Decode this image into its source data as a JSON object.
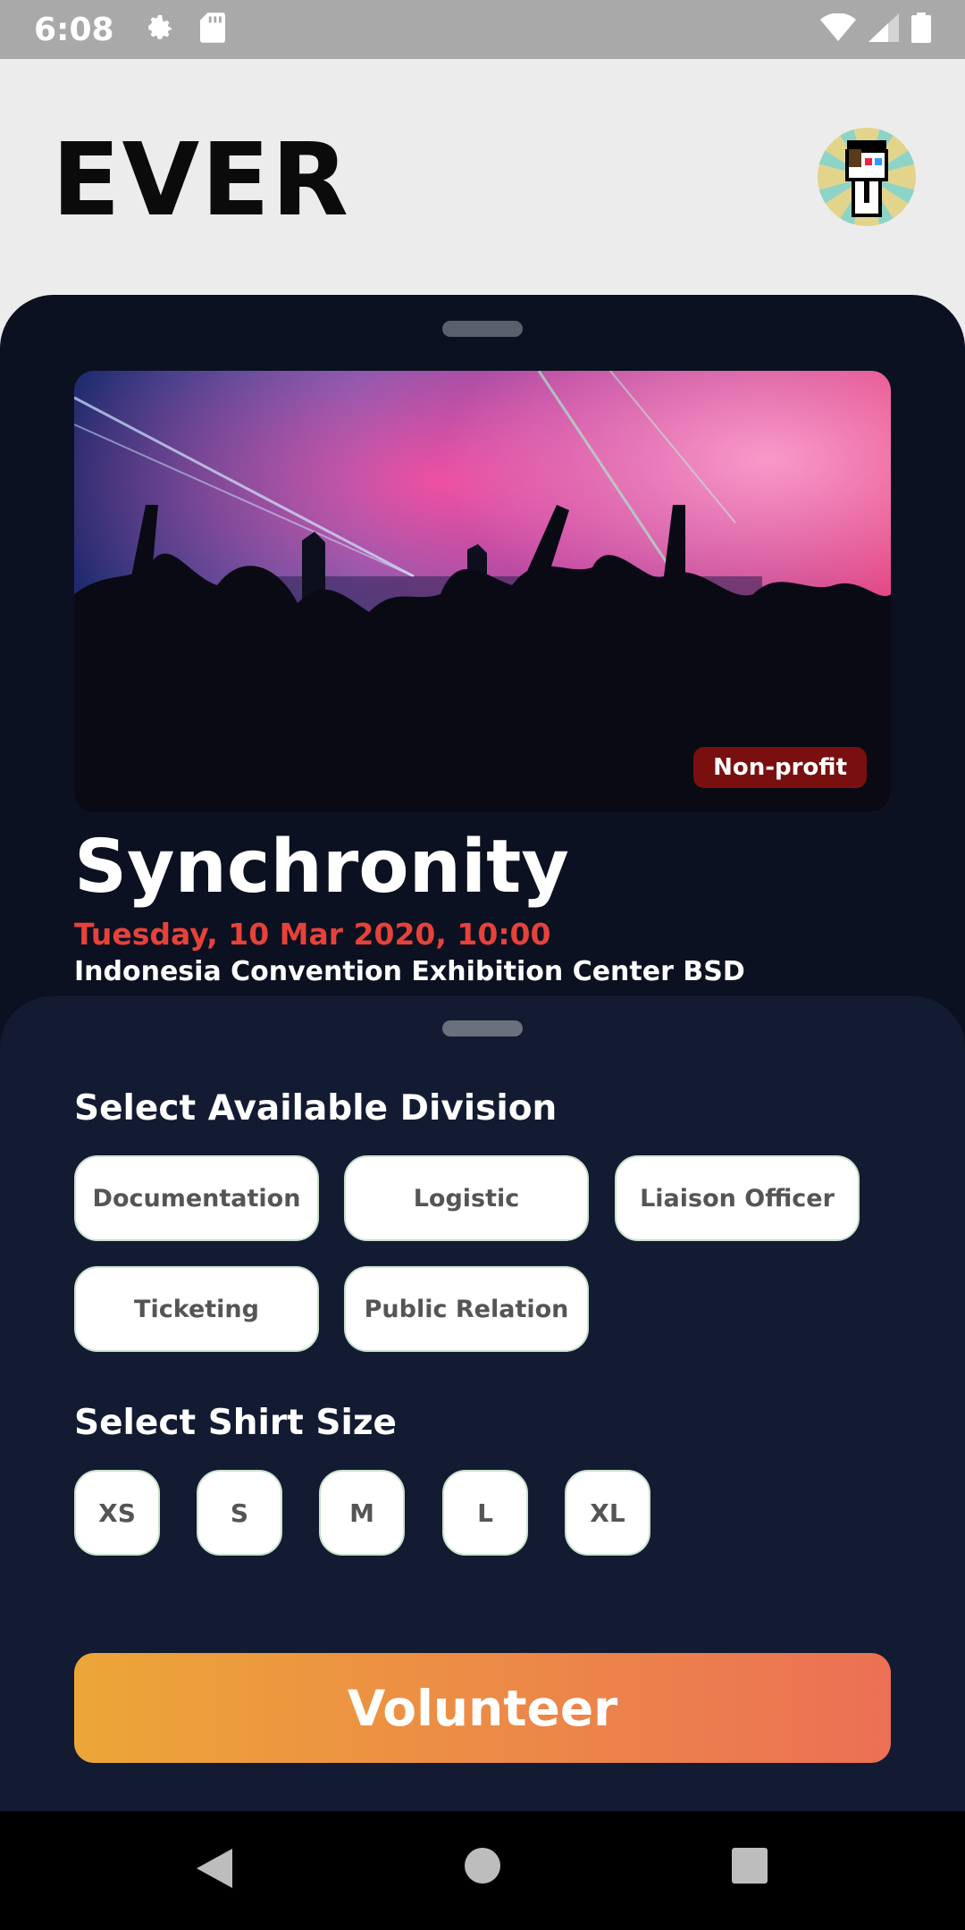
{
  "status_bar": {
    "time": "6:08",
    "icons_left": [
      "settings-icon",
      "sd-card-icon"
    ],
    "icons_right": [
      "wifi-icon",
      "signal-icon",
      "battery-icon"
    ]
  },
  "header": {
    "logo": "EVER",
    "avatar": "pixel-avatar"
  },
  "event": {
    "badge": "Non-profit",
    "title": "Synchronity",
    "date": "Tuesday, 10 Mar 2020, 10:00",
    "venue": "Indonesia Convention Exhibition Center BSD"
  },
  "division": {
    "title": "Select Available Division",
    "options": [
      "Documentation",
      "Logistic",
      "Liaison Officer",
      "Ticketing",
      "Public Relation"
    ]
  },
  "shirt": {
    "title": "Select Shirt Size",
    "sizes": [
      "XS",
      "S",
      "M",
      "L",
      "XL"
    ]
  },
  "action": {
    "volunteer_label": "Volunteer"
  },
  "colors": {
    "panel": "#0b1120",
    "sheet": "#121b31",
    "date_red": "#e6423a",
    "badge": "#7a0f0f",
    "button_start": "#eca637",
    "button_end": "#ec7055"
  },
  "nav": [
    "back-icon",
    "home-icon",
    "recents-icon"
  ]
}
